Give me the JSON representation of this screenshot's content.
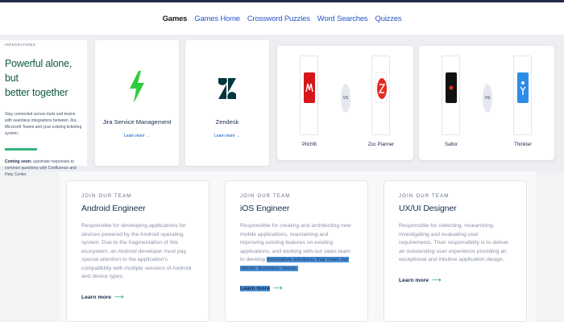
{
  "nav": {
    "items": [
      {
        "label": "Games",
        "active": true
      },
      {
        "label": "Games Home",
        "active": false
      },
      {
        "label": "Crossword Puzzles",
        "active": false
      },
      {
        "label": "Word Searches",
        "active": false
      },
      {
        "label": "Quizzes",
        "active": false
      }
    ]
  },
  "intro": {
    "kicker": "INTEGRATIONS",
    "title_line1": "Powerful alone, but",
    "title_line2": "better together",
    "body": "Stay connected across tools and teams with seamless integrations between Jira, Microsoft Teams and your existing ticketing system.",
    "soon_label": "Coming soon:",
    "soon_text": " automate responses to common questions with Confluence and Help Center."
  },
  "products": [
    {
      "name": "Jira Service Management",
      "link": "Learn more →",
      "icon": "jira-service-management-icon"
    },
    {
      "name": "Zendesk",
      "link": "Learn more →",
      "icon": "zendesk-icon"
    }
  ],
  "comparisons": [
    {
      "left": "Pitchfit",
      "right": "Zoc Planner",
      "vs": "VS",
      "left_color": "#d6161b",
      "right_color": "#e42a23"
    },
    {
      "left": "Sattor",
      "right": "Thinkter",
      "vs": "VS",
      "left_color": "#111111",
      "right_color": "#2d8de6"
    }
  ],
  "jobs": [
    {
      "kicker": "JOIN OUR TEAM",
      "title": "Android Engineer",
      "desc": "Responsible for developing applications for devices powered by the Android operating system. Due to the fragmentation of this ecosystem, an Android developer must pay special attention to the application's compatibility with multiple versions of Android and device types.",
      "learn": "Learn more"
    },
    {
      "kicker": "JOIN OUR TEAM",
      "title": "iOS Engineer",
      "desc_plain": "Responsible for creating and architecting new mobile applications, maintaining and improving existing features on existing applications, and working with our sales team to develop ",
      "desc_highlight": "innovative solutions that meet our clients' business needs.",
      "learn": "Learn more"
    },
    {
      "kicker": "JOIN OUR TEAM",
      "title": "UX/UI Designer",
      "desc": "Responsible for collecting, researching, investigating and evaluating user requirements. Their responsibility is to deliver an outstanding user experience providing an exceptional and intuitive application design.",
      "learn": "Learn more"
    }
  ],
  "colors": {
    "accent_green": "#36b37e",
    "link_blue": "#0052cc",
    "selection": "#4a8fd6"
  }
}
